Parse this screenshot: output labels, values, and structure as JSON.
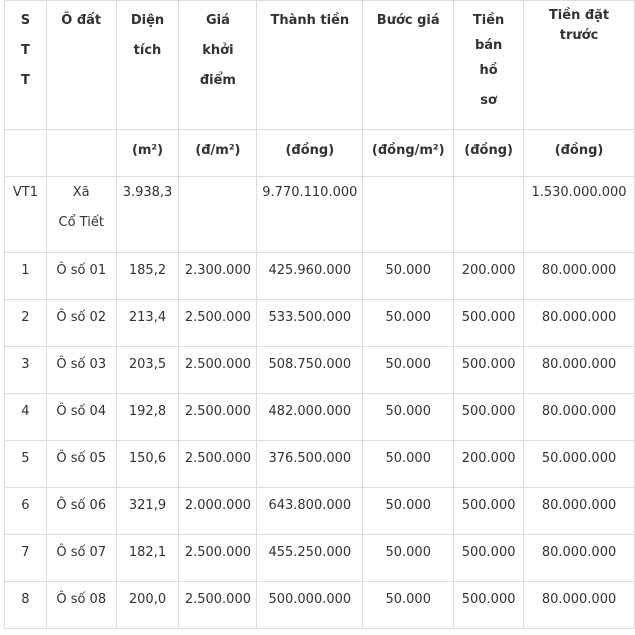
{
  "headers": {
    "stt": [
      "S",
      "T",
      "T"
    ],
    "o_dat": "Ô đất",
    "dien_tich": [
      "Diện",
      "tích"
    ],
    "gia_khoi_diem": [
      "Giá",
      "khởi",
      "điểm"
    ],
    "thanh_tien": "Thành tiền",
    "buoc_gia": "Bước giá",
    "tien_ban_ho_so": [
      "Tiền",
      "bán",
      "hồ",
      "sơ"
    ],
    "tien_dat_truoc": [
      "Tiền đặt",
      "trước"
    ]
  },
  "units": [
    "",
    "",
    "(m²)",
    "(đ/m²)",
    "(đồng)",
    "(đồng/m²)",
    "(đồng)",
    "(đồng)"
  ],
  "group": {
    "stt": "VT1",
    "o_dat": [
      "Xã",
      "Cổ Tiết"
    ],
    "dien_tich": "3.938,3",
    "gia_khoi_diem": "",
    "thanh_tien": "9.770.110.000",
    "buoc_gia": "",
    "tien_ban_ho_so": "",
    "tien_dat_truoc": "1.530.000.000"
  },
  "rows": [
    [
      "1",
      "Ô số 01",
      "185,2",
      "2.300.000",
      "425.960.000",
      "50.000",
      "200.000",
      "80.000.000"
    ],
    [
      "2",
      "Ô số 02",
      "213,4",
      "2.500.000",
      "533.500.000",
      "50.000",
      "500.000",
      "80.000.000"
    ],
    [
      "3",
      "Ô số 03",
      "203,5",
      "2.500.000",
      "508.750.000",
      "50.000",
      "500.000",
      "80.000.000"
    ],
    [
      "4",
      "Ô số 04",
      "192,8",
      "2.500.000",
      "482.000.000",
      "50.000",
      "500.000",
      "80.000.000"
    ],
    [
      "5",
      "Ô số 05",
      "150,6",
      "2.500.000",
      "376.500.000",
      "50.000",
      "200.000",
      "50.000.000"
    ],
    [
      "6",
      "Ô số 06",
      "321,9",
      "2.000.000",
      "643.800.000",
      "50.000",
      "500.000",
      "80.000.000"
    ],
    [
      "7",
      "Ô số 07",
      "182,1",
      "2.500.000",
      "455.250.000",
      "50.000",
      "500.000",
      "80.000.000"
    ],
    [
      "8",
      "Ô số 08",
      "200,0",
      "2.500.000",
      "500.000.000",
      "50.000",
      "500.000",
      "80.000.000"
    ]
  ]
}
